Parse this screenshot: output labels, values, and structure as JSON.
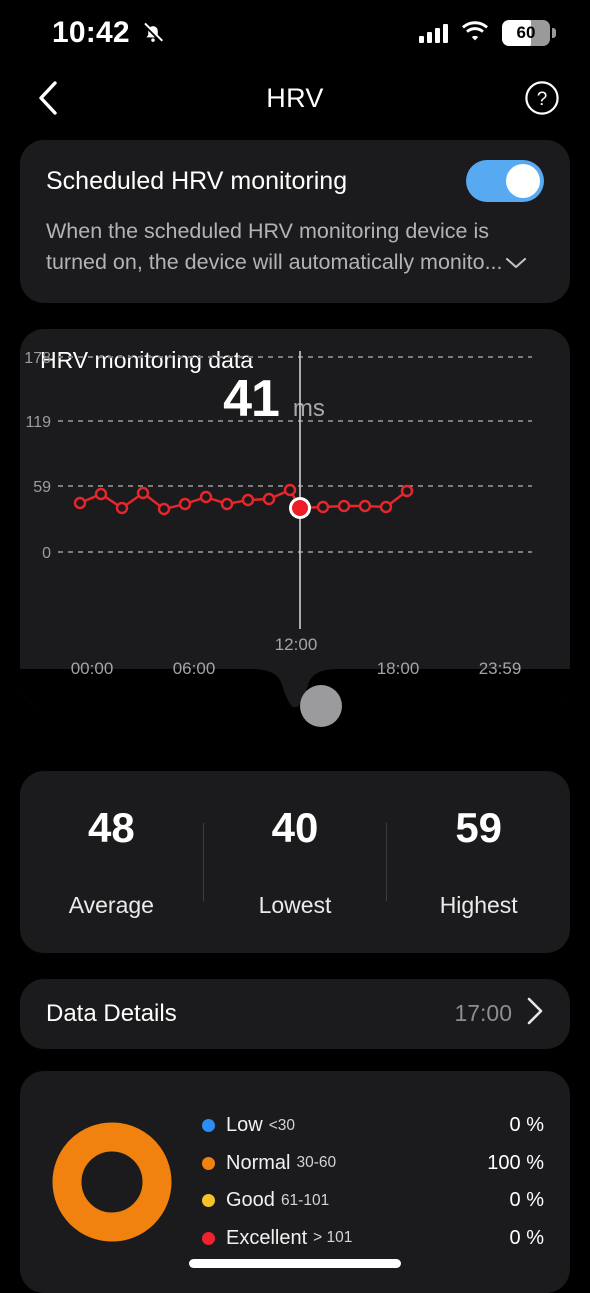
{
  "status_bar": {
    "time": "10:42",
    "notifications_icon": "bell-off-icon",
    "signal_icon": "cellular-signal-icon",
    "wifi_icon": "wifi-icon",
    "battery_level": "60"
  },
  "nav": {
    "back_icon": "chevron-left-icon",
    "title": "HRV",
    "help_icon": "question-mark-circle-icon"
  },
  "scheduled": {
    "title": "Scheduled HRV monitoring",
    "description": "When the scheduled HRV monitoring device is turned on, the device will automatically monito...",
    "expand_icon": "chevron-down-icon",
    "toggle_state": "on",
    "toggle_color": "#57a9f2"
  },
  "chart_card": {
    "title": "HRV monitoring data",
    "selected_value": "41",
    "unit": "ms",
    "handle_icon": "drag-handle-circle"
  },
  "chart_data": {
    "type": "line",
    "title": "HRV monitoring data",
    "xlabel": "",
    "ylabel": "ms",
    "ylim": [
      0,
      178
    ],
    "yticks": [
      0,
      59,
      119,
      178
    ],
    "ytick_labels": [
      "0",
      "59",
      "119",
      "178"
    ],
    "xticks": [
      "00:00",
      "06:00",
      "12:00",
      "18:00",
      "23:59"
    ],
    "xtick_positions": [
      0,
      6,
      12,
      18,
      23.983
    ],
    "grid": true,
    "legend": "none",
    "line_color": "#e8262c",
    "marker": "open-circle",
    "selected_point": {
      "x_time": "12:00",
      "value": 41,
      "label": "41 ms"
    },
    "x": [
      0.7,
      1.7,
      2.6,
      3.6,
      4.6,
      5.6,
      6.6,
      7.6,
      8.6,
      9.6,
      10.6,
      11.55,
      12.05,
      13.0,
      14.0,
      15.0,
      16.0,
      17.0
    ],
    "values": [
      45,
      53,
      40,
      54,
      39,
      44,
      50,
      44,
      48,
      49,
      57,
      40,
      41,
      47,
      46,
      46,
      44,
      58
    ],
    "series": [
      {
        "name": "HRV",
        "color": "#e8262c",
        "values": [
          45,
          53,
          40,
          54,
          39,
          44,
          50,
          44,
          48,
          49,
          57,
          40,
          41,
          47,
          46,
          46,
          44,
          58
        ]
      }
    ]
  },
  "stats": {
    "items": [
      {
        "value": "48",
        "label": "Average"
      },
      {
        "value": "40",
        "label": "Lowest"
      },
      {
        "value": "59",
        "label": "Highest"
      }
    ]
  },
  "data_details": {
    "label": "Data Details",
    "time": "17:00",
    "chevron_icon": "chevron-right-icon"
  },
  "distribution": {
    "donut_color": "#f2820f",
    "rows": [
      {
        "name": "Low",
        "range": "<30",
        "percent": "0 %",
        "color": "#2c8ef4"
      },
      {
        "name": "Normal",
        "range": "30-60",
        "percent": "100 %",
        "color": "#f2820f"
      },
      {
        "name": "Good",
        "range": "61-101",
        "percent": "0 %",
        "color": "#f4c329"
      },
      {
        "name": "Excellent",
        "range": "> 101",
        "percent": "0 %",
        "color": "#f0222c"
      }
    ]
  }
}
